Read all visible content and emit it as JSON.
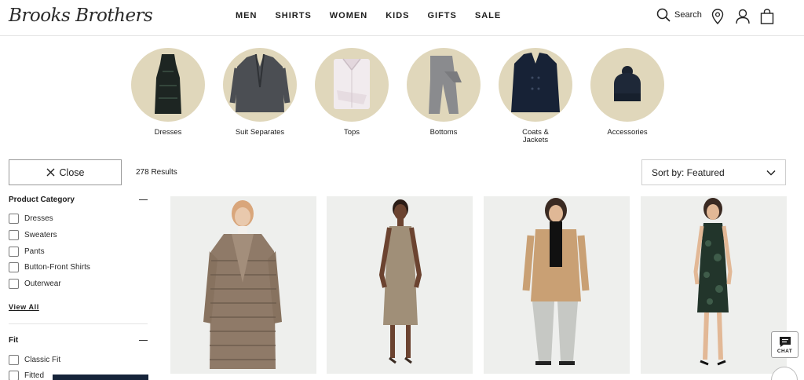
{
  "header": {
    "logo_text": "Brooks Brothers",
    "nav": [
      "MEN",
      "SHIRTS",
      "WOMEN",
      "KIDS",
      "GIFTS",
      "SALE"
    ],
    "search_label": "Search",
    "icons": [
      "search-icon",
      "location-pin-icon",
      "account-icon",
      "shopping-bag-icon"
    ]
  },
  "categories": [
    {
      "label": "Dresses",
      "icon": "dress-thumbnail"
    },
    {
      "label": "Suit Separates",
      "icon": "blazer-thumbnail"
    },
    {
      "label": "Tops",
      "icon": "folded-shirt-thumbnail"
    },
    {
      "label": "Bottoms",
      "icon": "trousers-thumbnail"
    },
    {
      "label": "Coats & Jackets",
      "line1": "Coats &",
      "line2": "Jackets",
      "icon": "coat-thumbnail"
    },
    {
      "label": "Accessories",
      "icon": "beanie-thumbnail"
    }
  ],
  "toolbar": {
    "close_label": "Close",
    "results_text": "278 Results",
    "sort_label": "Sort by: Featured"
  },
  "filters": {
    "product_category": {
      "title": "Product Category",
      "options": [
        "Dresses",
        "Sweaters",
        "Pants",
        "Button-Front Shirts",
        "Outerwear"
      ],
      "view_all": "View All"
    },
    "fit": {
      "title": "Fit",
      "options": [
        "Classic Fit",
        "Fitted"
      ]
    }
  },
  "products": [
    {
      "description": "puffer-coat",
      "color": "#8f7a68"
    },
    {
      "description": "sheath-dress",
      "color": "#a08f78"
    },
    {
      "description": "camel-coat",
      "color": "#c9a074"
    },
    {
      "description": "jacquard-dress",
      "color": "#22352b"
    }
  ],
  "chat": {
    "label": "CHAT"
  },
  "colors": {
    "circle_bg": "#e0d7bb",
    "tile_bg": "#eeefed",
    "navy": "#16243a"
  }
}
